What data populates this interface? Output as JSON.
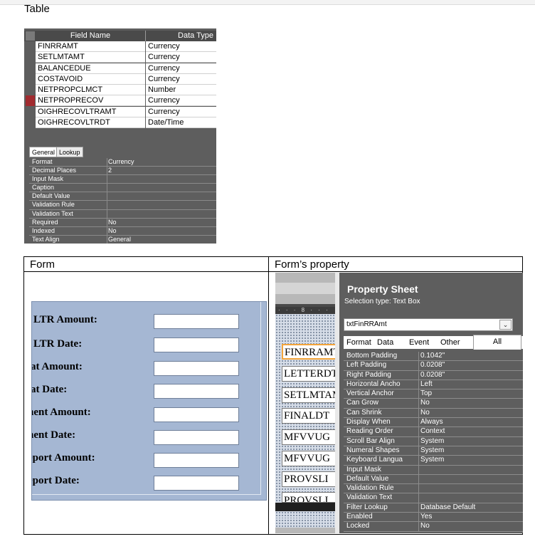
{
  "doc": {
    "table_label": "Table",
    "form_header": "Form",
    "form_property_header": "Form’s property"
  },
  "table_design": {
    "columns": {
      "field_name": "Field Name",
      "data_type": "Data Type"
    },
    "rows": [
      {
        "field": "FINRRAMT",
        "type": "Currency"
      },
      {
        "field": "SETLMTAMT",
        "type": "Currency"
      },
      {
        "field": "BALANCEDUE",
        "type": "Currency"
      },
      {
        "field": "COSTAVOID",
        "type": "Currency"
      },
      {
        "field": "NETPROPCLMCT",
        "type": "Number"
      },
      {
        "field": "NETPROPRECOV",
        "type": "Currency"
      },
      {
        "field": "OIGHRECOVLTRAMT",
        "type": "Currency"
      },
      {
        "field": "OIGHRECOVLTRDT",
        "type": "Date/Time"
      }
    ],
    "tabs": {
      "general": "General",
      "lookup": "Lookup"
    },
    "properties": [
      {
        "name": "Format",
        "value": "Currency"
      },
      {
        "name": "Decimal Places",
        "value": "2"
      },
      {
        "name": "Input Mask",
        "value": ""
      },
      {
        "name": "Caption",
        "value": ""
      },
      {
        "name": "Default Value",
        "value": ""
      },
      {
        "name": "Validation Rule",
        "value": ""
      },
      {
        "name": "Validation Text",
        "value": ""
      },
      {
        "name": "Required",
        "value": "No"
      },
      {
        "name": "Indexed",
        "value": "No"
      },
      {
        "name": "Text Align",
        "value": "General"
      }
    ]
  },
  "form": {
    "labels": [
      "LTR Amount:",
      "LTR Date:",
      "at Amount:",
      "at Date:",
      "nent Amount:",
      "nent Date:",
      "eport Amount:",
      "eport Date:"
    ]
  },
  "designer": {
    "ruler": "· · · 8 · · ·",
    "controls": [
      "FINRRAMT",
      "LETTERDT",
      "SETLMTAMT",
      "FINALDT",
      "MFVVUG",
      "MFVVUG",
      "PROVSLI",
      "PROVSLI"
    ]
  },
  "property_sheet": {
    "title": "Property Sheet",
    "selection_type": "Selection type:  Text Box",
    "selected_control": "txtFinRRAmt",
    "dropdown_icon": "chevron-down-icon",
    "tabs": [
      "Format",
      "Data",
      "Event",
      "Other",
      "All"
    ],
    "active_tab": "All",
    "rows": [
      {
        "name": "Bottom Padding",
        "value": "0.1042\""
      },
      {
        "name": "Left Padding",
        "value": "0.0208\""
      },
      {
        "name": "Right Padding",
        "value": "0.0208\""
      },
      {
        "name": "Horizontal Ancho",
        "value": "Left"
      },
      {
        "name": "Vertical Anchor",
        "value": "Top"
      },
      {
        "name": "Can Grow",
        "value": "No"
      },
      {
        "name": "Can Shrink",
        "value": "No"
      },
      {
        "name": "Display When",
        "value": "Always"
      },
      {
        "name": "Reading Order",
        "value": "Context"
      },
      {
        "name": "Scroll Bar Align",
        "value": "System"
      },
      {
        "name": "Numeral Shapes",
        "value": "System"
      },
      {
        "name": "Keyboard Langua",
        "value": "System"
      },
      {
        "name": "Input Mask",
        "value": ""
      },
      {
        "name": "Default Value",
        "value": ""
      },
      {
        "name": "Validation Rule",
        "value": ""
      },
      {
        "name": "Validation Text",
        "value": ""
      },
      {
        "name": "Filter Lookup",
        "value": "Database Default"
      },
      {
        "name": "Enabled",
        "value": "Yes"
      },
      {
        "name": "Locked",
        "value": "No"
      }
    ]
  },
  "colors": {
    "form_back": "#a5b7d3",
    "selected_row_marker": "#a12b2f",
    "sheet_back": "#5e5e5e",
    "designer_selection": "#f3a43a"
  }
}
